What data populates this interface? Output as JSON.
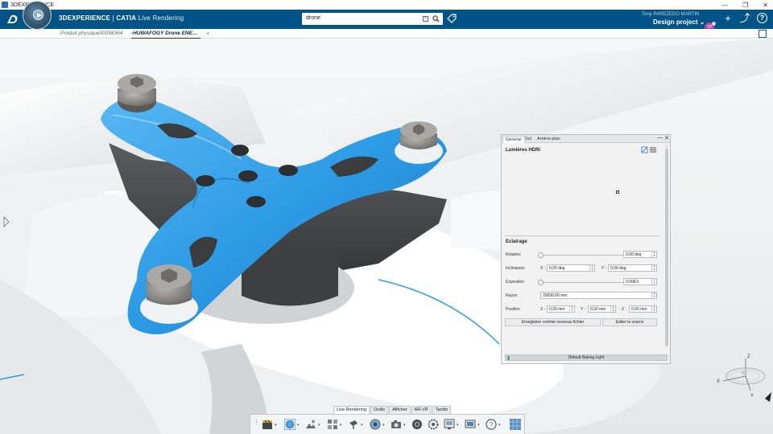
{
  "os": {
    "title": "3DEXPERIENCE",
    "controls": [
      "—",
      "❐",
      "✕"
    ]
  },
  "header": {
    "brand_bold": "3DEXPERIENCE",
    "brand_sep": " | ",
    "brand_app": "CATIA",
    "brand_module": " Live Rendering",
    "search_value": "drone",
    "user_name": "Tony PAREZEDO MARTIN",
    "project": "Design project ⌄",
    "avatar_initials": "TP",
    "add_icon": "+",
    "share_icon": "⤴",
    "help_icon": "?"
  },
  "tabs": [
    {
      "label": "Produit physique00058364"
    },
    {
      "label": "-HUWAFOGY Drone ENE…"
    }
  ],
  "tab_add": "+",
  "panel": {
    "tabs": [
      "Général",
      "Sol",
      "Arrière-plan"
    ],
    "min_icon": "—",
    "close_icon": "✕",
    "title": "Lumières HDRi",
    "section": "Eclairage",
    "rotation_label": "Rotation",
    "rotation_value": "0,00 deg",
    "inclinaison_label": "Inclinaison",
    "incl_x_label": "X :",
    "incl_x_value": "0,00 deg",
    "incl_y_label": "Y :",
    "incl_y_value": "0,00 deg",
    "exposition_label": "Exposition",
    "exposition_value": "0,00EV",
    "rayon_label": "Rayon",
    "rayon_value": "20000,00 mm",
    "position_label": "Position",
    "pos_x_label": "X :",
    "pos_x_value": "0,00 mm",
    "pos_y_label": "Y :",
    "pos_y_value": "0,00 mm",
    "pos_z_label": "Z :",
    "pos_z_value": "0,00 mm",
    "save_button": "Enregistrer comme nouveau fichier",
    "edit_button": "Editer la source",
    "footer": "Default Baking Light"
  },
  "actionbar": {
    "tabs": [
      "Live Rendering",
      "Outils",
      "Afficher",
      "AR-VR",
      "Tactile"
    ],
    "active_tab": "Live Rendering"
  },
  "triad": {
    "x": "X",
    "y": "Y",
    "z": "Z"
  },
  "colors": {
    "header_bg": "#005386",
    "part_blue": "#2e9be6",
    "accent": "#0a5e8f"
  }
}
